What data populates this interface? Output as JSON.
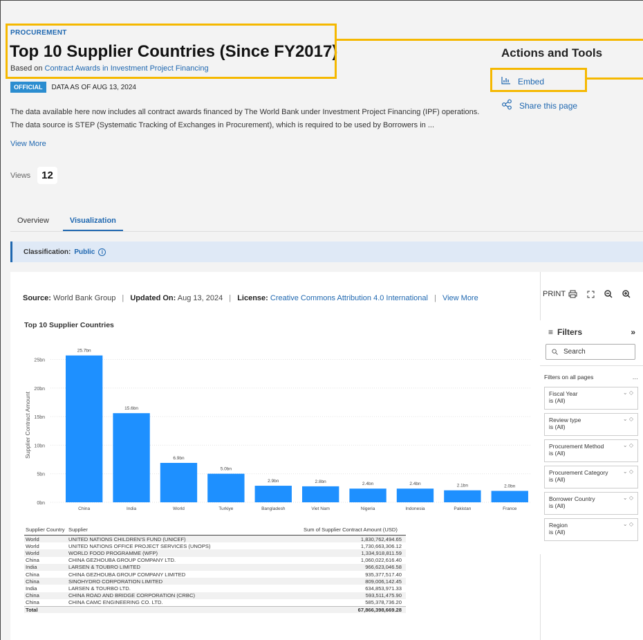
{
  "header": {
    "eyebrow": "PROCUREMENT",
    "title": "Top 10 Supplier Countries (Since FY2017)",
    "subtitle_prefix": "Based on",
    "subtitle_link": "Contract Awards in Investment Project Financing",
    "badge": "OFFICIAL",
    "data_as_of": "DATA AS OF AUG 13, 2024",
    "description_line1": "The data available here now includes all contract awards financed by The World Bank under Investment Project Financing (IPF) operations.",
    "description_line2": "The data source is STEP (Systematic Tracking of Exchanges in Procurement), which is required to be used by Borrowers in ...",
    "view_more": "View More",
    "views_label": "Views",
    "views_count": "12"
  },
  "tools": {
    "title": "Actions and Tools",
    "embed": "Embed",
    "share": "Share this page"
  },
  "tabs": [
    {
      "label": "Overview",
      "active": false
    },
    {
      "label": "Visualization",
      "active": true
    }
  ],
  "classification": {
    "label": "Classification:",
    "value": "Public"
  },
  "viz_meta": {
    "source_label": "Source:",
    "source": "World Bank Group",
    "updated_label": "Updated On:",
    "updated": "Aug 13, 2024",
    "license_label": "License:",
    "license": "Creative Commons Attribution 4.0 International",
    "view_more": "View More"
  },
  "toolbar": {
    "print": "PRINT"
  },
  "chart_data": {
    "type": "bar",
    "title": "Top 10 Supplier Countries",
    "ylabel": "Supplier Contract Amount",
    "xlabel": "",
    "categories": [
      "China",
      "India",
      "World",
      "Turkiye",
      "Bangladesh",
      "Viet Nam",
      "Nigeria",
      "Indonesia",
      "Pakistan",
      "France"
    ],
    "values": [
      25.7,
      15.6,
      6.9,
      5.0,
      2.9,
      2.8,
      2.4,
      2.4,
      2.1,
      2.0
    ],
    "data_labels": [
      "25.7bn",
      "15.6bn",
      "6.9bn",
      "5.0bn",
      "2.9bn",
      "2.8bn",
      "2.4bn",
      "2.4bn",
      "2.1bn",
      "2.0bn"
    ],
    "yticks": [
      0,
      5,
      10,
      15,
      20,
      25
    ],
    "ytick_labels": [
      "0bn",
      "5bn",
      "10bn",
      "15bn",
      "20bn",
      "25bn"
    ],
    "ylim": [
      0,
      27
    ],
    "grid": true,
    "bar_color": "#1e90ff"
  },
  "table": {
    "headers": [
      "Supplier Country",
      "Supplier",
      "Sum of Supplier Contract Amount (USD)"
    ],
    "rows": [
      [
        "World",
        "UNITED NATIONS CHILDREN'S FUND (UNICEF)",
        "1,830,762,494.65"
      ],
      [
        "World",
        "UNITED NATIONS OFFICE PROJECT SERVICES (UNOPS)",
        "1,730,663,306.12"
      ],
      [
        "World",
        "WORLD FOOD PROGRAMME (WFP)",
        "1,334,918,811.59"
      ],
      [
        "China",
        "CHINA GEZHOUBA GROUP COMPANY LTD.",
        "1,060,022,616.40"
      ],
      [
        "India",
        "LARSEN & TOUBRO LIMITED",
        "966,623,046.58"
      ],
      [
        "China",
        "CHINA GEZHOUBA GROUP COMPANY LIMITED",
        "935,377,517.40"
      ],
      [
        "China",
        "SINOHYDRO CORPORATION LIMITED",
        "809,006,142.45"
      ],
      [
        "India",
        "LARSEN & TOURBO LTD.",
        "634,853,971.33"
      ],
      [
        "China",
        "CHINA ROAD AND BRIDGE CORPORATION (CRBC)",
        "593,511,475.90"
      ],
      [
        "China",
        "CHINA CAMC ENGINEERING CO. LTD.",
        "585,378,736.20"
      ]
    ],
    "total_label": "Total",
    "total_value": "67,866,398,669.28"
  },
  "filters": {
    "title": "Filters",
    "search_placeholder": "Search",
    "section": "Filters on all pages",
    "items": [
      {
        "name": "Fiscal Year",
        "state": "is (All)"
      },
      {
        "name": "Review type",
        "state": "is (All)"
      },
      {
        "name": "Procurement Method",
        "state": "is (All)"
      },
      {
        "name": "Procurement Category",
        "state": "is (All)"
      },
      {
        "name": "Borrower Country",
        "state": "is (All)"
      },
      {
        "name": "Region",
        "state": "is (All)"
      }
    ]
  }
}
